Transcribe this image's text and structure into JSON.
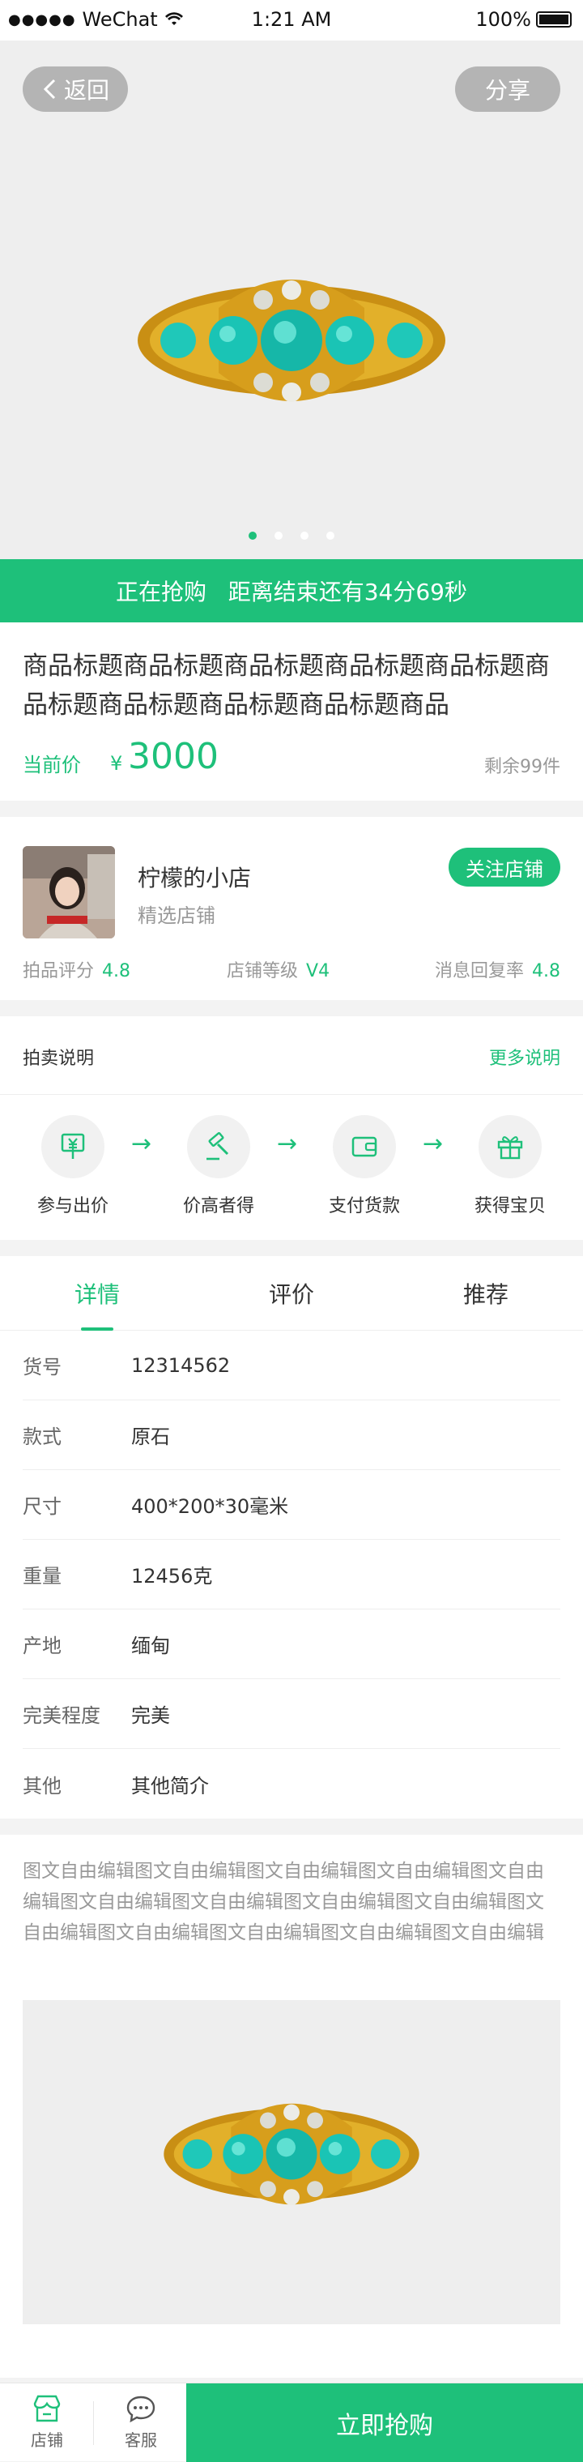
{
  "status_bar": {
    "signal": "●●●●●",
    "carrier": "WeChat",
    "time": "1:21 AM",
    "battery": "100%"
  },
  "header": {
    "back_label": "返回",
    "share_label": "分享"
  },
  "carousel": {
    "dots": 4,
    "active_index": 0
  },
  "banner": {
    "text": "正在抢购   距离结束还有34分69秒"
  },
  "product": {
    "title": "商品标题商品标题商品标题商品标题商品标题商品标题商品标题商品标题商品标题商品",
    "price_label": "当前价",
    "currency": "¥",
    "price": "3000",
    "remaining": "剩余99件"
  },
  "shop": {
    "name": "柠檬的小店",
    "subtitle": "精选店铺",
    "follow_label": "关注店铺",
    "stats": [
      {
        "label": "拍品评分",
        "value": "4.8"
      },
      {
        "label": "店铺等级",
        "value": "V4"
      },
      {
        "label": "消息回复率",
        "value": "4.8"
      }
    ]
  },
  "auction": {
    "title": "拍卖说明",
    "more_label": "更多说明",
    "arrow": "→",
    "steps": [
      {
        "label": "参与出价",
        "icon": "yen-price-icon"
      },
      {
        "label": "价高者得",
        "icon": "gavel-icon"
      },
      {
        "label": "支付货款",
        "icon": "wallet-icon"
      },
      {
        "label": "获得宝贝",
        "icon": "gift-icon"
      }
    ]
  },
  "tabs": [
    {
      "label": "详情",
      "active": true
    },
    {
      "label": "评价",
      "active": false
    },
    {
      "label": "推荐",
      "active": false
    }
  ],
  "specs": [
    {
      "key": "货号",
      "value": "12314562"
    },
    {
      "key": "款式",
      "value": "原石"
    },
    {
      "key": "尺寸",
      "value": "400*200*30毫米"
    },
    {
      "key": "重量",
      "value": "12456克"
    },
    {
      "key": "产地",
      "value": "缅甸"
    },
    {
      "key": "完美程度",
      "value": "完美"
    },
    {
      "key": "其他",
      "value": "其他简介"
    }
  ],
  "description": {
    "text": "图文自由编辑图文自由编辑图文自由编辑图文自由编辑图文自由编辑图文自由编辑图文自由编辑图文自由编辑图文自由编辑图文自由编辑图文自由编辑图文自由编辑图文自由编辑图文自由编辑"
  },
  "bottom_bar": {
    "shop_label": "店铺",
    "service_label": "客服",
    "buy_label": "立即抢购"
  },
  "colors": {
    "accent": "#1ec07a",
    "turquoise": "#1fc8b9",
    "gold": "#d8a31c"
  }
}
